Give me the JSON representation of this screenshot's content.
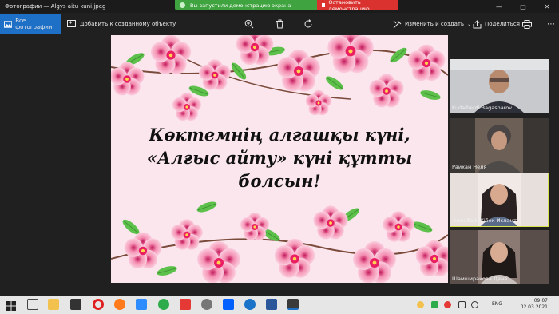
{
  "window": {
    "title": "Фотографии — Algys aitu kuni.jpeg",
    "controls": [
      "—",
      "□",
      "✕"
    ]
  },
  "share_banner": {
    "message": "Вы запустили демонстрацию экрана",
    "stop_label": "Остановить демонстрацию"
  },
  "toolbar": {
    "all_photos": "Все фотографии",
    "add_to_album": "Добавить к созданному объекту",
    "edit_create": "Изменить и создать",
    "share": "Поделиться"
  },
  "slide": {
    "line1": "Көктемнің алғашқы күні,",
    "line2": "«Алғыс айту» күні құтты",
    "line3": "болсын!"
  },
  "participants": [
    {
      "name": "Kudaiberdi Bagasharov"
    },
    {
      "name": "Райхан Неля"
    },
    {
      "name": "Аманбай Жібек Исламт..."
    },
    {
      "name": "Шамширакова Дана"
    }
  ],
  "taskbar": {
    "time": "09:07",
    "date": "02.03.2021",
    "language": "ENG"
  },
  "colors": {
    "accent": "#1e6fc6",
    "share_green": "#3fa33f",
    "stop_red": "#d9322f"
  }
}
